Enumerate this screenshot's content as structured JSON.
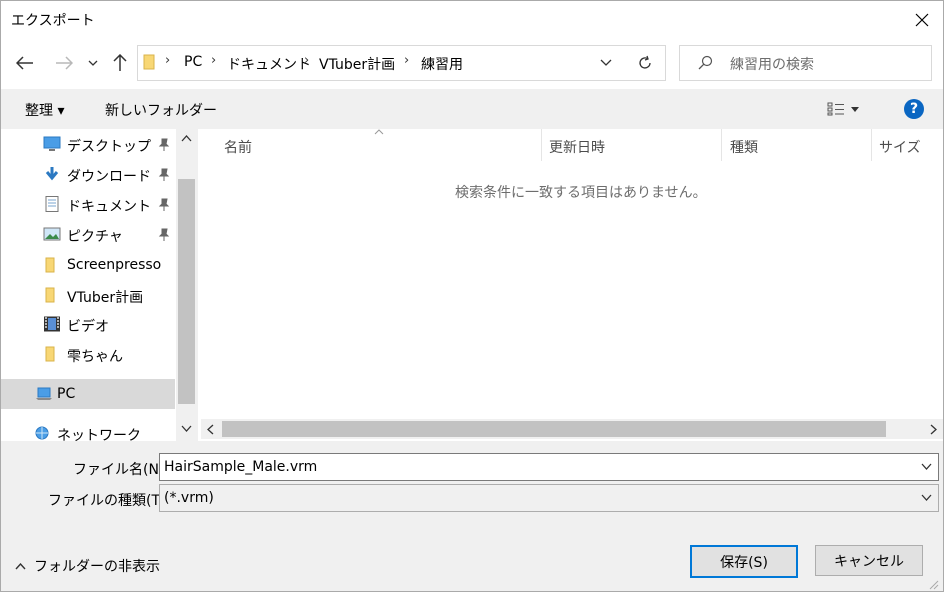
{
  "window": {
    "title": "エクスポート"
  },
  "breadcrumb": {
    "items": [
      "PC",
      "ドキュメント",
      "VTuber計画",
      "練習用"
    ]
  },
  "search": {
    "placeholder": "練習用の検索"
  },
  "toolbar": {
    "organize": "整理 ▾",
    "new_folder": "新しいフォルダー"
  },
  "sidebar": {
    "items": [
      {
        "label": "デスクトップ",
        "icon": "desktop-icon",
        "pinned": true
      },
      {
        "label": "ダウンロード",
        "icon": "download-icon",
        "pinned": true
      },
      {
        "label": "ドキュメント",
        "icon": "document-icon",
        "pinned": true
      },
      {
        "label": "ピクチャ",
        "icon": "pictures-icon",
        "pinned": true
      },
      {
        "label": "Screenpresso",
        "icon": "folder-icon",
        "pinned": false
      },
      {
        "label": "VTuber計画",
        "icon": "folder-icon",
        "pinned": false
      },
      {
        "label": "ビデオ",
        "icon": "video-icon",
        "pinned": false
      },
      {
        "label": "雫ちゃん",
        "icon": "folder-icon",
        "pinned": false
      }
    ],
    "pc": "PC",
    "network": "ネットワーク"
  },
  "columns": [
    "名前",
    "更新日時",
    "種類",
    "サイズ"
  ],
  "empty_message": "検索条件に一致する項目はありません。",
  "form": {
    "filename_label": "ファイル名(N):",
    "filename_value": "HairSample_Male.vrm",
    "filetype_label": "ファイルの種類(T):",
    "filetype_value": "(*.vrm)"
  },
  "footer": {
    "hide_folders": "フォルダーの非表示",
    "save": "保存(S)",
    "cancel": "キャンセル"
  },
  "colors": {
    "accent": "#0078d7",
    "help": "#0a66c2",
    "folder": "#f8d775"
  }
}
